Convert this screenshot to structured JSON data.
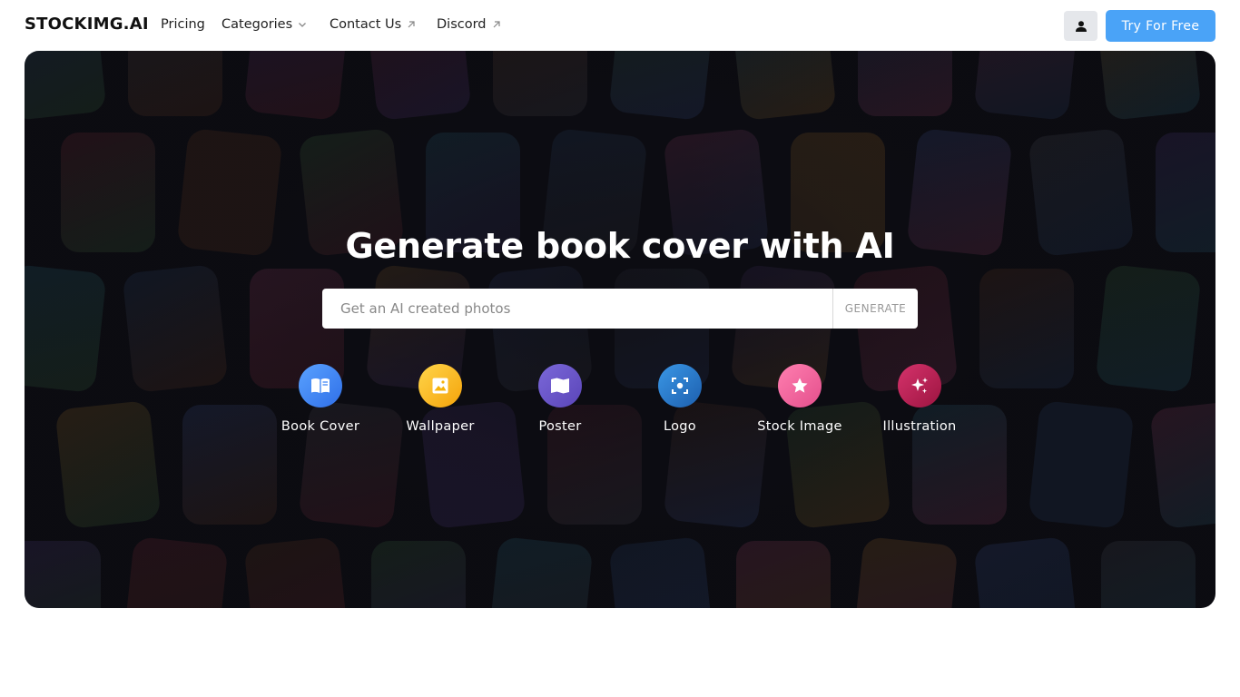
{
  "nav": {
    "logo": "STOCKIMG.AI",
    "links": [
      {
        "label": "Pricing",
        "icon": ""
      },
      {
        "label": "Categories",
        "icon": "chevron-down-icon"
      },
      {
        "label": "Contact Us",
        "icon": "external-arrow-icon"
      },
      {
        "label": "Discord",
        "icon": "external-arrow-icon"
      }
    ],
    "user_icon": "user-icon",
    "cta_label": "Try For Free"
  },
  "hero": {
    "title": "Generate book cover with AI",
    "search_placeholder": "Get an AI created photos",
    "generate_label": "GENERATE",
    "categories": [
      {
        "label": "Book Cover",
        "icon": "book-open-icon",
        "color": "#3b82f6"
      },
      {
        "label": "Wallpaper",
        "icon": "image-icon",
        "color": "#f5b20a"
      },
      {
        "label": "Poster",
        "icon": "map-icon",
        "color": "#6b56c9"
      },
      {
        "label": "Logo",
        "icon": "focus-icon",
        "color": "#2b7fd0"
      },
      {
        "label": "Stock Image",
        "icon": "star-icon",
        "color": "#f0629c"
      },
      {
        "label": "Illustration",
        "icon": "sparkles-icon",
        "color": "#c21e56"
      }
    ]
  },
  "colors": {
    "accent": "#4aa3f7",
    "hero_bg": "#0c0c12"
  }
}
